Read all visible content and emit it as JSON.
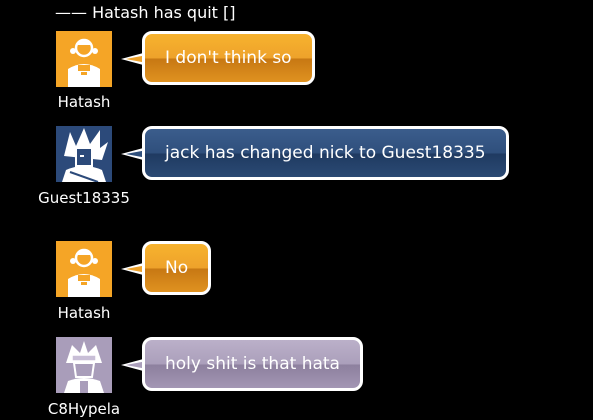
{
  "system_message": "—— Hatash has quit []",
  "messages": [
    {
      "nick": "Hatash",
      "text": "I don't think so",
      "bubble_color": "#eea22b",
      "avatar_icon": "orange-girl-avatar-icon"
    },
    {
      "nick": "Guest18335",
      "text": "jack has changed nick to Guest18335",
      "bubble_color": "#2f4f7c",
      "avatar_icon": "spiky-hair-avatar-icon"
    },
    {
      "nick": "Hatash",
      "text": "No",
      "bubble_color": "#eea22b",
      "avatar_icon": "orange-girl-avatar-icon"
    },
    {
      "nick": "C8Hypela",
      "text": "holy shit is that hata",
      "bubble_color": "#ab9fbb",
      "avatar_icon": "lilac-ninja-avatar-icon"
    }
  ]
}
